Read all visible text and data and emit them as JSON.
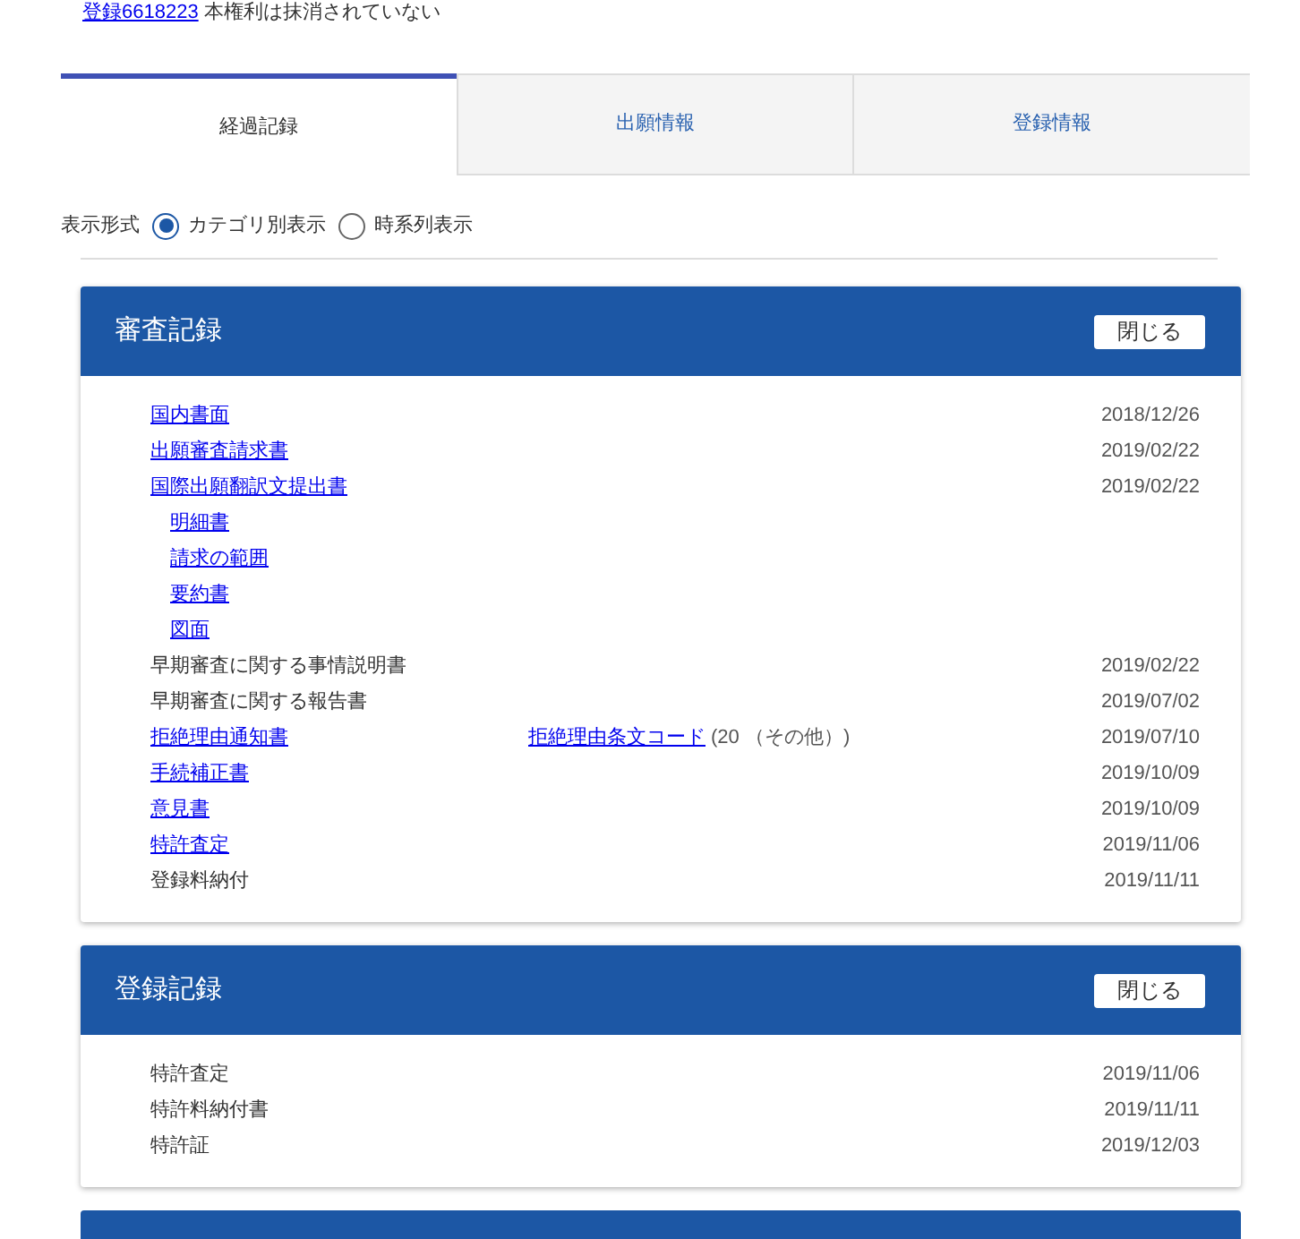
{
  "status_line": {
    "link": "登録6618223",
    "text": "本権利は抹消されていない"
  },
  "tabs": [
    {
      "label": "経過記録",
      "selected": true
    },
    {
      "label": "出願情報",
      "selected": false
    },
    {
      "label": "登録情報",
      "selected": false
    }
  ],
  "display_format": {
    "label": "表示形式",
    "options": [
      {
        "label": "カテゴリ別表示",
        "selected": true
      },
      {
        "label": "時系列表示",
        "selected": false
      }
    ]
  },
  "sections": [
    {
      "title": "審査記録",
      "button": "閉じる",
      "rows": [
        {
          "label": "国内書面",
          "kind": "link",
          "date": "2018/12/26"
        },
        {
          "label": "出願審査請求書",
          "kind": "link",
          "date": "2019/02/22"
        },
        {
          "label": "国際出願翻訳文提出書",
          "kind": "link",
          "date": "2019/02/22",
          "children": [
            {
              "label": "明細書",
              "kind": "link"
            },
            {
              "label": "請求の範囲",
              "kind": "link"
            },
            {
              "label": "要約書",
              "kind": "link"
            },
            {
              "label": "図面",
              "kind": "link"
            }
          ]
        },
        {
          "label": "早期審査に関する事情説明書",
          "kind": "text",
          "date": "2019/02/22"
        },
        {
          "label": "早期審査に関する報告書",
          "kind": "text",
          "date": "2019/07/02"
        },
        {
          "label": "拒絶理由通知書",
          "kind": "link",
          "code_link": "拒絶理由条文コード",
          "code_note": "(20 （その他）)",
          "date": "2019/07/10"
        },
        {
          "label": "手続補正書",
          "kind": "link",
          "date": "2019/10/09"
        },
        {
          "label": "意見書",
          "kind": "link",
          "date": "2019/10/09"
        },
        {
          "label": "特許査定",
          "kind": "link",
          "date": "2019/11/06"
        },
        {
          "label": "登録料納付",
          "kind": "text",
          "date": "2019/11/11"
        }
      ]
    },
    {
      "title": "登録記録",
      "button": "閉じる",
      "rows": [
        {
          "label": "特許査定",
          "kind": "text",
          "date": "2019/11/06"
        },
        {
          "label": "特許料納付書",
          "kind": "text",
          "date": "2019/11/11"
        },
        {
          "label": "特許証",
          "kind": "text",
          "date": "2019/12/03"
        }
      ]
    }
  ]
}
